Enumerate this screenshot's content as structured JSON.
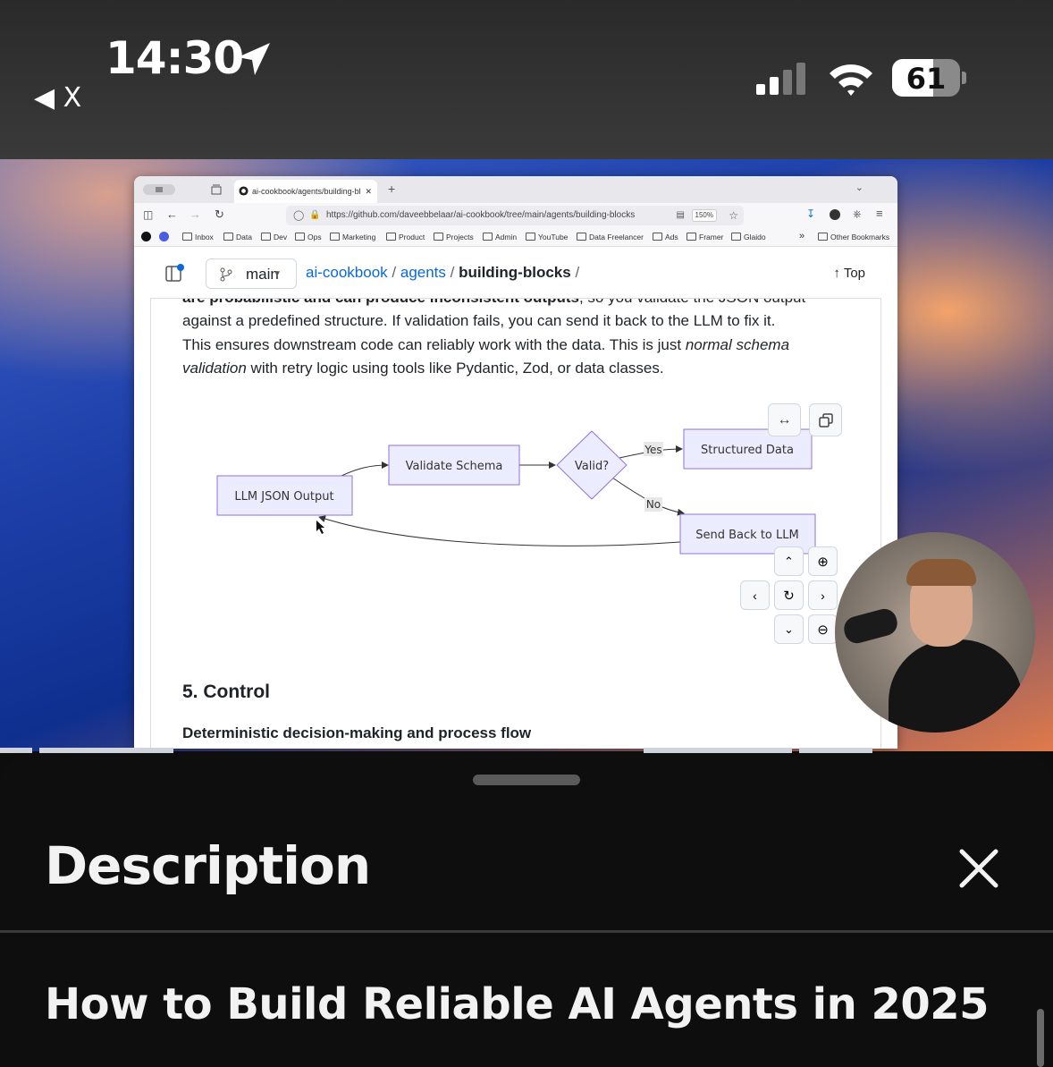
{
  "status_bar": {
    "time": "14:30",
    "back_label": "X",
    "battery": "61"
  },
  "browser": {
    "tab_title": "ai-cookbook/agents/building-bl",
    "url": "https://github.com/daveebbelaar/ai-cookbook/tree/main/agents/building-blocks",
    "zoom": "150%",
    "bookmarks": [
      "Inbox",
      "Data",
      "Dev",
      "Ops",
      "Marketing",
      "Product",
      "Projects",
      "Admin",
      "YouTube",
      "Data Freelancer",
      "Ads",
      "Framer",
      "Glaido"
    ],
    "other_bookmarks": "Other Bookmarks"
  },
  "github": {
    "branch": "main",
    "crumbs": [
      "ai-cookbook",
      "agents",
      "building-blocks"
    ],
    "top": "Top"
  },
  "article": {
    "line1_bold": "are probabilistic and can produce inconsistent outputs",
    "line1_rest": ", so you validate the JSON output",
    "line2": "against a predefined structure. If validation fails, you can send it back to the LLM to fix it.",
    "line3a": "This ensures downstream code can reliably work with the data. This is just ",
    "line3_em": "normal schema",
    "line4_em": "validation",
    "line4_rest": " with retry logic using tools like Pydantic, Zod, or data classes.",
    "section_heading": "5. Control",
    "section_sub": "Deterministic decision-making and process flow"
  },
  "diagram": {
    "nodes": {
      "llm_output": "LLM JSON Output",
      "validate": "Validate Schema",
      "valid": "Valid?",
      "structured": "Structured Data",
      "send_back": "Send Back to LLM"
    },
    "edges": {
      "yes": "Yes",
      "no": "No"
    }
  },
  "sheet": {
    "heading": "Description",
    "video_title": "How to Build Reliable AI Agents in 2025"
  },
  "colors": {
    "link": "#0969da",
    "node_fill": "#ececff",
    "node_stroke": "#9370db",
    "sheet_bg": "#0e0e0e"
  }
}
